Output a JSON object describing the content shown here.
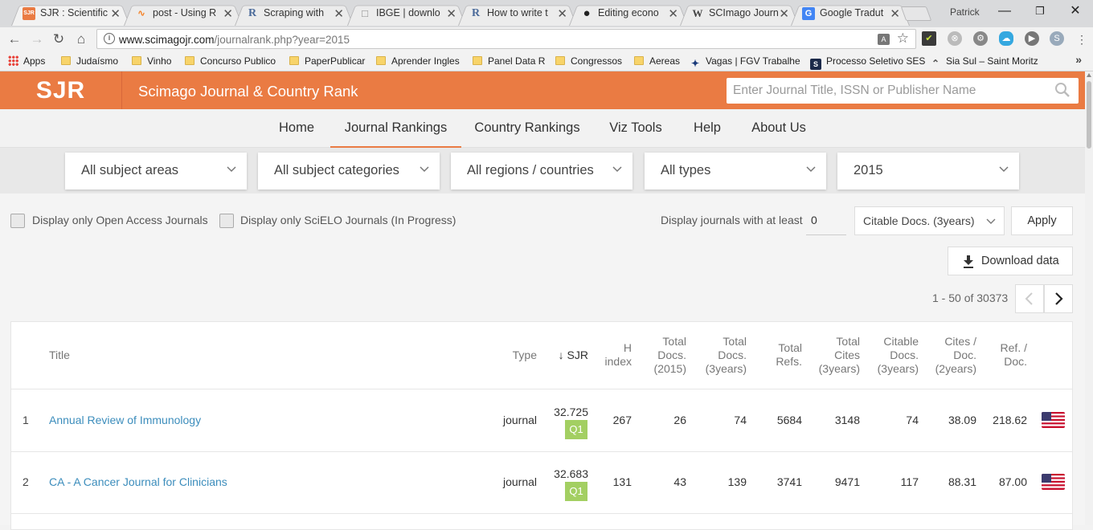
{
  "browser": {
    "tabs": [
      {
        "label": "SJR : Scientific",
        "favicon": "SJR",
        "favicon_color": "#ea7b43"
      },
      {
        "label": "post - Using R",
        "favicon": "∿",
        "favicon_color": "#f48024"
      },
      {
        "label": "Scraping with",
        "favicon": "R",
        "favicon_color": "#4a6a9a"
      },
      {
        "label": "IBGE | downlo",
        "favicon": "□",
        "favicon_color": "#888888"
      },
      {
        "label": "How to write t",
        "favicon": "R",
        "favicon_color": "#4a6a9a"
      },
      {
        "label": "Editing econo",
        "favicon": "●",
        "favicon_color": "#222222"
      },
      {
        "label": "SCImago Journ",
        "favicon": "W",
        "favicon_color": "#555555"
      },
      {
        "label": "Google Tradut",
        "favicon": "G",
        "favicon_color": "#4285f4"
      }
    ],
    "tab_close": "✕",
    "profile": "Patrick",
    "window": {
      "minimize": "—",
      "restore": "❐",
      "close": "✕"
    },
    "url_host": "www.scimagojr.com",
    "url_path": "/journalrank.php?year=2015",
    "bookmarks": [
      {
        "label": "Apps",
        "kind": "apps"
      },
      {
        "label": "Judaísmo",
        "kind": "folder"
      },
      {
        "label": "Vinho",
        "kind": "folder"
      },
      {
        "label": "Concurso Publico",
        "kind": "folder"
      },
      {
        "label": "PaperPublicar",
        "kind": "folder"
      },
      {
        "label": "Aprender Ingles",
        "kind": "folder"
      },
      {
        "label": "Panel Data R",
        "kind": "folder"
      },
      {
        "label": "Congressos",
        "kind": "folder"
      },
      {
        "label": "Aereas",
        "kind": "folder"
      },
      {
        "label": "Vagas | FGV Trabalhe",
        "kind": "site"
      },
      {
        "label": "Processo Seletivo SES",
        "kind": "site"
      },
      {
        "label": "Sia Sul – Saint Moritz",
        "kind": "site"
      }
    ],
    "more_bookmarks": "»"
  },
  "site": {
    "logo": "SJR",
    "title": "Scimago Journal & Country Rank",
    "search_placeholder": "Enter Journal Title, ISSN or Publisher Name",
    "accent": "#ea7b43"
  },
  "nav": [
    "Home",
    "Journal Rankings",
    "Country Rankings",
    "Viz Tools",
    "Help",
    "About Us"
  ],
  "nav_active": "Journal Rankings",
  "filters": {
    "subject_area": "All subject areas",
    "subject_category": "All subject categories",
    "region": "All regions / countries",
    "type": "All types",
    "year": "2015"
  },
  "options": {
    "open_access_label": "Display only Open Access Journals",
    "scielo_label": "Display only SciELO Journals (In Progress)",
    "at_least_label": "Display journals with at least",
    "min_value": "0",
    "citable_select": "Citable Docs. (3years)",
    "apply": "Apply",
    "download": "Download data",
    "pager_text": "1 - 50 of 30373"
  },
  "table": {
    "headers": {
      "title": "Title",
      "type": "Type",
      "sjr": "↓ SJR",
      "h_index": "H\nindex",
      "total_docs_year": "Total\nDocs.\n(2015)",
      "total_docs_3y": "Total\nDocs.\n(3years)",
      "total_refs": "Total\nRefs.",
      "total_cites_3y": "Total\nCites\n(3years)",
      "citable_docs_3y": "Citable\nDocs.\n(3years)",
      "cites_per_doc": "Cites /\nDoc.\n(2years)",
      "ref_per_doc": "Ref. /\nDoc."
    },
    "rows": [
      {
        "rank": "1",
        "title": "Annual Review of Immunology",
        "type": "journal",
        "sjr": "32.725",
        "quartile": "Q1",
        "h_index": "267",
        "total_docs": "26",
        "total_docs_3y": "74",
        "total_refs": "5684",
        "total_cites_3y": "3148",
        "citable_docs_3y": "74",
        "cites_per_doc": "38.09",
        "ref_per_doc": "218.62",
        "country": "United States"
      },
      {
        "rank": "2",
        "title": "CA - A Cancer Journal for Clinicians",
        "type": "journal",
        "sjr": "32.683",
        "quartile": "Q1",
        "h_index": "131",
        "total_docs": "43",
        "total_docs_3y": "139",
        "total_refs": "3741",
        "total_cites_3y": "9471",
        "citable_docs_3y": "117",
        "cites_per_doc": "88.31",
        "ref_per_doc": "87.00",
        "country": "United States"
      }
    ]
  }
}
